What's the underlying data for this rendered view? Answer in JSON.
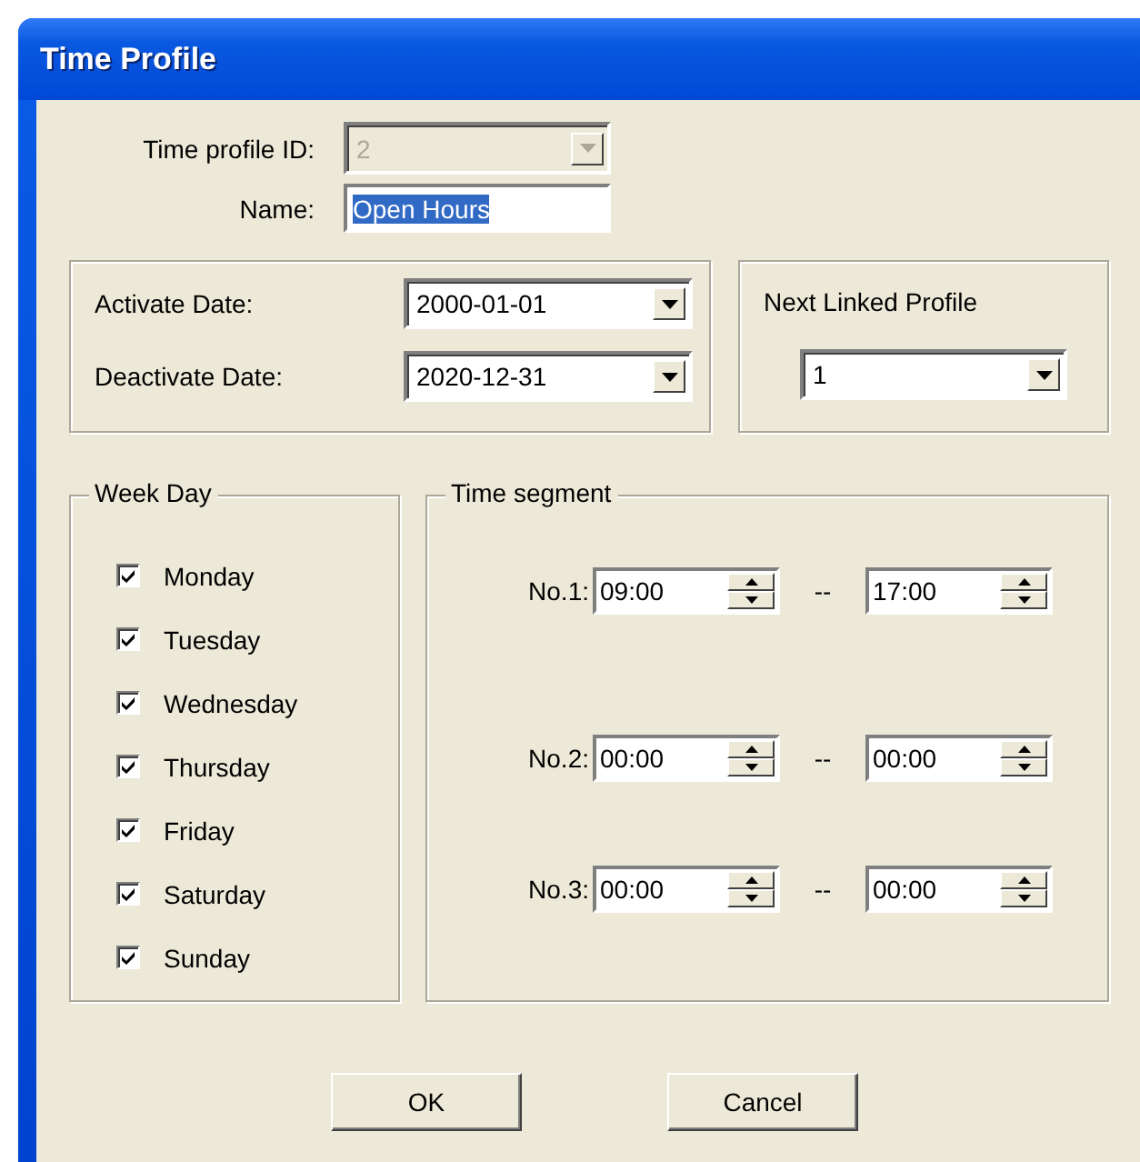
{
  "window": {
    "title": "Time Profile"
  },
  "profile_id": {
    "label": "Time profile ID:",
    "value": "2",
    "disabled": true
  },
  "name": {
    "label": "Name:",
    "value": "Open Hours",
    "selected": true
  },
  "dates": [
    {
      "label": "Activate Date:",
      "value": "2000-01-01"
    },
    {
      "label": "Deactivate Date:",
      "value": "2020-12-31"
    }
  ],
  "next_linked_profile": {
    "label": "Next Linked Profile",
    "value": "1"
  },
  "week_day": {
    "title": "Week Day",
    "days": [
      {
        "label": "Monday",
        "checked": true
      },
      {
        "label": "Tuesday",
        "checked": true
      },
      {
        "label": "Wednesday",
        "checked": true
      },
      {
        "label": "Thursday",
        "checked": true
      },
      {
        "label": "Friday",
        "checked": true
      },
      {
        "label": "Saturday",
        "checked": true
      },
      {
        "label": "Sunday",
        "checked": true
      }
    ]
  },
  "time_segment": {
    "title": "Time segment",
    "segments": [
      {
        "label": "No.1:",
        "start": "09:00",
        "separator": "--",
        "end": "17:00"
      },
      {
        "label": "No.2:",
        "start": "00:00",
        "separator": "--",
        "end": "00:00"
      },
      {
        "label": "No.3:",
        "start": "00:00",
        "separator": "--",
        "end": "00:00"
      }
    ]
  },
  "buttons": [
    "OK",
    "Cancel"
  ]
}
